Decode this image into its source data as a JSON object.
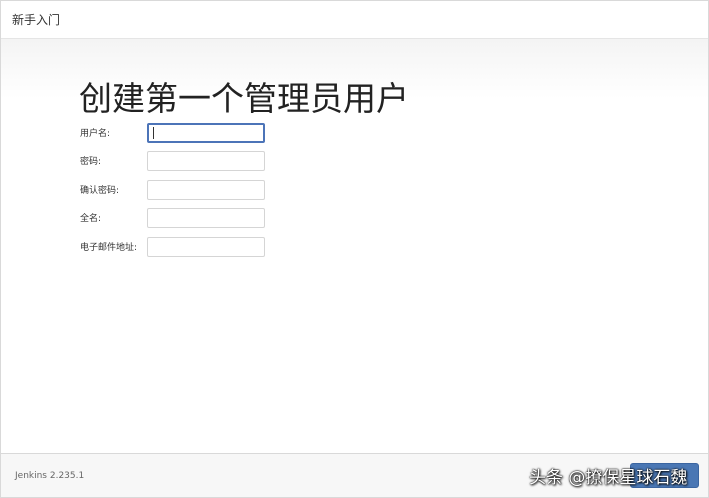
{
  "header": {
    "title": "新手入门"
  },
  "page": {
    "title": "创建第一个管理员用户"
  },
  "form": {
    "fields": [
      {
        "label": "用户名:",
        "value": "",
        "placeholder": ""
      },
      {
        "label": "密码:",
        "value": "",
        "placeholder": ""
      },
      {
        "label": "确认密码:",
        "value": "",
        "placeholder": ""
      },
      {
        "label": "全名:",
        "value": "",
        "placeholder": ""
      },
      {
        "label": "电子邮件地址:",
        "value": "",
        "placeholder": ""
      }
    ]
  },
  "footer": {
    "version": "Jenkins 2.235.1"
  },
  "watermark": {
    "text": "头条 @撩保星球石魏"
  },
  "colors": {
    "accent": "#4a77b4",
    "focus_border": "#4c74b8"
  }
}
